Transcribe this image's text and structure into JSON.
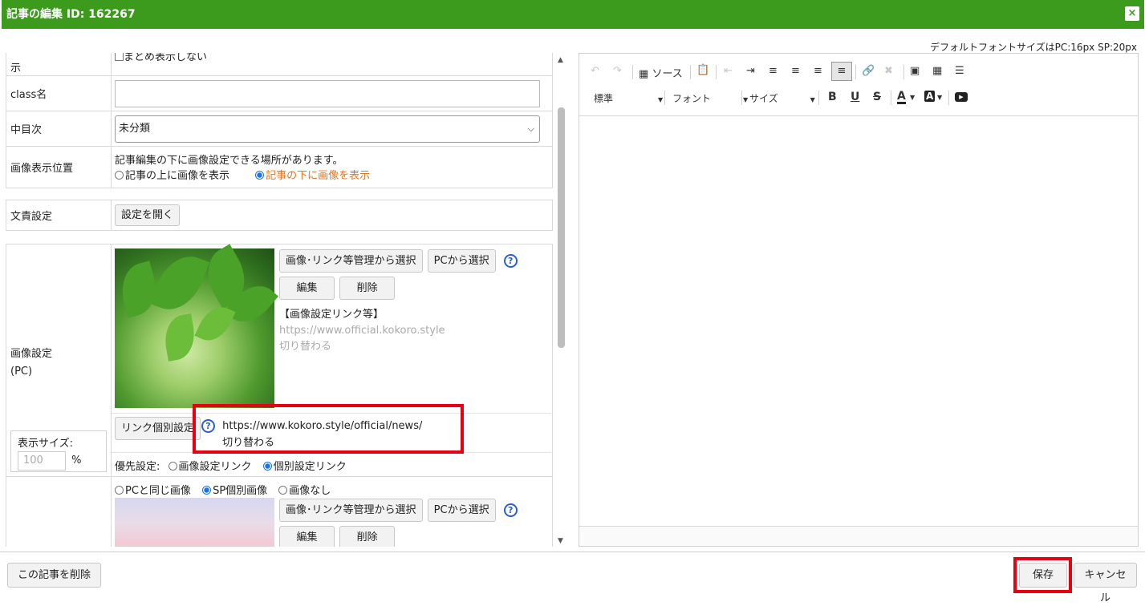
{
  "dialog": {
    "title": "記事の編集 ID: 162267",
    "close_icon": "×"
  },
  "font_note": "デフォルトフォントサイズはPC:16px SP:20px",
  "form": {
    "row_display": {
      "label": "示",
      "checkbox_label": "まとめ表示しない"
    },
    "row_class": {
      "label": "class名",
      "value": ""
    },
    "row_toc": {
      "label": "中目次",
      "selected": "未分類"
    },
    "row_image_position": {
      "label": "画像表示位置",
      "note": "記事編集の下に画像設定できる場所があります。",
      "options": [
        {
          "label": "記事の上に画像を表示",
          "checked": false
        },
        {
          "label": "記事の下に画像を表示",
          "checked": true
        }
      ]
    },
    "row_text_settings": {
      "label": "文責設定",
      "button": "設定を開く"
    },
    "row_image_pc": {
      "label_line1": "画像設定",
      "label_line2": "(PC)",
      "select_from_manager": "画像･リンク等管理から選択",
      "select_from_pc": "PCから選択",
      "edit": "編集",
      "delete": "削除",
      "link_heading": "【画像設定リンク等】",
      "link_url": "https://www.official.kokoro.style",
      "link_mode": "切り替わる",
      "display_size_label": "表示サイズ:",
      "display_size_placeholder": "100",
      "percent": "%",
      "individual_link_button": "リンク個別設定",
      "individual_url": "https://www.kokoro.style/official/news/",
      "individual_mode": "切り替わる",
      "priority_label": "優先設定:",
      "priority_options": [
        {
          "label": "画像設定リンク",
          "checked": false
        },
        {
          "label": "個別設定リンク",
          "checked": true
        }
      ]
    },
    "row_image_sp": {
      "options": [
        {
          "label": "PCと同じ画像",
          "checked": false
        },
        {
          "label": "SP個別画像",
          "checked": true
        },
        {
          "label": "画像なし",
          "checked": false
        }
      ],
      "select_from_manager": "画像･リンク等管理から選択",
      "select_from_pc": "PCから選択",
      "edit": "編集",
      "delete": "削除"
    }
  },
  "editor": {
    "source_label": "ソース",
    "format_combo": "標準",
    "font_combo": "フォント",
    "size_combo": "サイズ",
    "bold": "B",
    "underline": "U",
    "strike": "S",
    "text_color": "A",
    "bg_color": "A"
  },
  "footer": {
    "delete_article": "この記事を削除",
    "save": "保存",
    "cancel": "キャンセル"
  },
  "colors": {
    "title_bar": "#3c9a1c",
    "highlight": "#e60012",
    "link_blue": "#2a5fd1",
    "selected_orange": "#e8731a"
  }
}
